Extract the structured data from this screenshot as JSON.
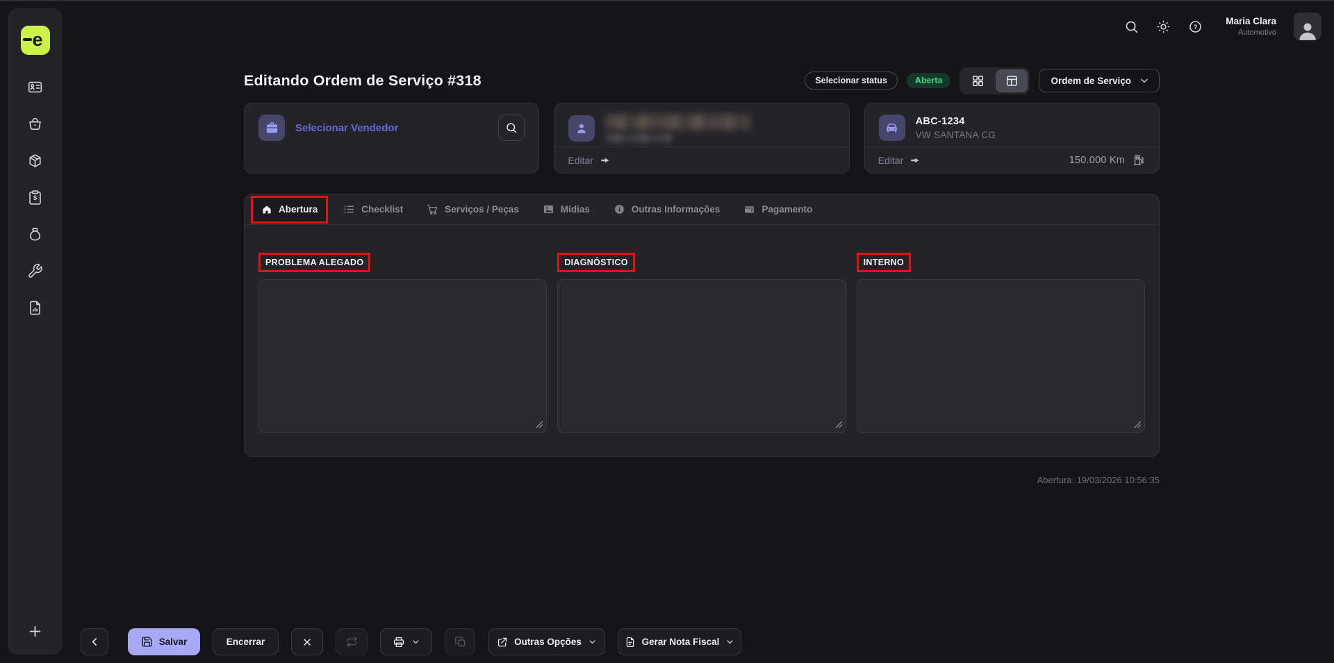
{
  "topbar": {
    "user_name": "Maria Clara",
    "user_role": "Automotivo"
  },
  "header": {
    "title": "Editando Ordem de Serviço #318",
    "status_selector": "Selecionar status",
    "status_badge": "Aberta",
    "document_type": "Ordem de Serviço"
  },
  "cards": {
    "vendor": {
      "label": "Selecionar Vendedor"
    },
    "customer": {
      "edit_label": "Editar",
      "name_redacted": true
    },
    "vehicle": {
      "plate": "ABC-1234",
      "model": "VW SANTANA CG",
      "edit_label": "Editar",
      "odometer": "150.000 Km"
    }
  },
  "tabs": [
    {
      "label": "Abertura",
      "active": true,
      "highlighted": true
    },
    {
      "label": "Checklist",
      "active": false
    },
    {
      "label": "Serviços / Peças",
      "active": false
    },
    {
      "label": "Mídias",
      "active": false
    },
    {
      "label": "Outras Informações",
      "active": false
    }
  ],
  "payment_tab": {
    "label": "Pagamento"
  },
  "fields": [
    {
      "label": "PROBLEMA ALEGADO",
      "value": "",
      "highlighted": true
    },
    {
      "label": "DIAGNÓSTICO",
      "value": "",
      "highlighted": true
    },
    {
      "label": "INTERNO",
      "value": "",
      "highlighted": true
    }
  ],
  "meta": {
    "opened_at": "Abertura: 19/03/2026 10:56:35"
  },
  "toolbar": {
    "save": "Salvar",
    "close_order": "Encerrar",
    "other_options": "Outras Opções",
    "generate_invoice": "Gerar Nota Fiscal"
  },
  "icons": [
    "search-icon",
    "brightness-icon",
    "help-icon",
    "avatar",
    "id-card-icon",
    "basket-icon",
    "package-icon",
    "invoice-icon",
    "money-bag-icon",
    "wrench-icon",
    "report-icon",
    "plus-icon",
    "briefcase-icon",
    "user-icon",
    "car-icon",
    "fuel-icon",
    "arrow-right-icon",
    "home-icon",
    "checklist-icon",
    "cart-icon",
    "image-icon",
    "info-icon",
    "wallet-icon",
    "grid-view-icon",
    "table-view-icon",
    "chevron-down-icon",
    "chevron-left-icon",
    "save-icon",
    "close-icon",
    "refresh-icon",
    "printer-icon",
    "copy-icon",
    "external-link-icon",
    "document-icon"
  ],
  "colors": {
    "accent_purple": "#6467dd",
    "chip_purple_bg": "#46466b",
    "chip_purple_icon": "#9a9cf2",
    "logo_lime": "#cbf247",
    "status_green_bg": "#16382a",
    "status_green_text": "#3fd97f",
    "save_button_bg": "#a7a9f4",
    "annotation_red": "#e01212"
  }
}
